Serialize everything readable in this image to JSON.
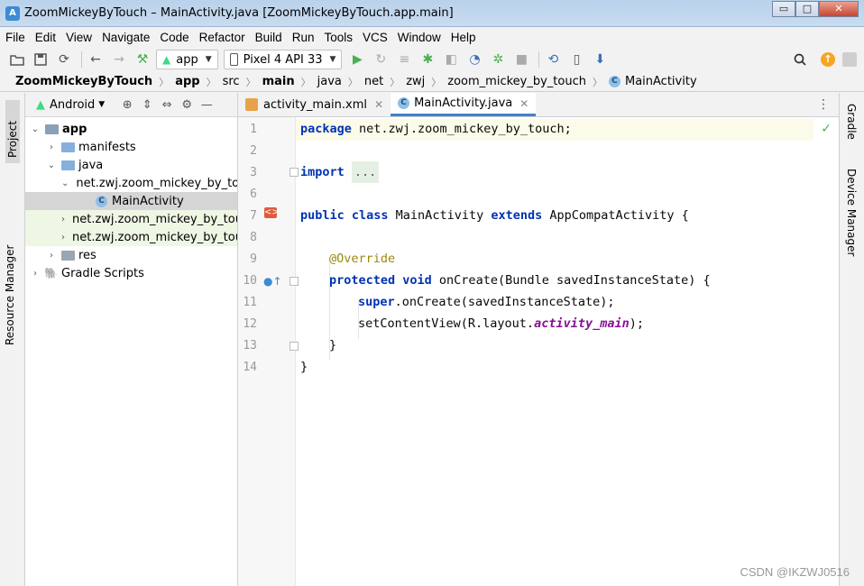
{
  "window": {
    "title": "ZoomMickeyByTouch – MainActivity.java [ZoomMickeyByTouch.app.main]",
    "controls": [
      "▭",
      "□",
      "✕"
    ]
  },
  "menu": [
    "File",
    "Edit",
    "View",
    "Navigate",
    "Code",
    "Refactor",
    "Build",
    "Run",
    "Tools",
    "VCS",
    "Window",
    "Help"
  ],
  "toolbar": {
    "run_config": "app",
    "device": "Pixel 4 API 33"
  },
  "breadcrumb": [
    "ZoomMickeyByTouch",
    "app",
    "src",
    "main",
    "java",
    "net",
    "zwj",
    "zoom_mickey_by_touch",
    "MainActivity"
  ],
  "left_strip": {
    "project_tab": "Project",
    "resource_tab": "Resource Manager"
  },
  "right_strip": {
    "gradle_tab": "Gradle",
    "device_tab": "Device Manager"
  },
  "project": {
    "view_mode": "Android",
    "tree": [
      {
        "label": "app",
        "depth": 0
      },
      {
        "label": "manifests",
        "depth": 1
      },
      {
        "label": "java",
        "depth": 1
      },
      {
        "label": "net.zwj.zoom_mickey_by_touch",
        "depth": 2
      },
      {
        "label": "MainActivity",
        "depth": 3
      },
      {
        "label": "net.zwj.zoom_mickey_by_touch",
        "depth": 2
      },
      {
        "label": "net.zwj.zoom_mickey_by_touch",
        "depth": 2
      },
      {
        "label": "res",
        "depth": 1
      },
      {
        "label": "Gradle Scripts",
        "depth": 0
      }
    ]
  },
  "tabs": [
    {
      "label": "activity_main.xml",
      "active": false
    },
    {
      "label": "MainActivity.java",
      "active": true
    }
  ],
  "editor": {
    "line_numbers": [
      "1",
      "2",
      "3",
      "6",
      "7",
      "8",
      "9",
      "10",
      "11",
      "12",
      "13",
      "14"
    ],
    "code": {
      "l1_kw": "package",
      "l1_rest": " net.zwj.zoom_mickey_by_touch;",
      "l3_kw": "import",
      "l3_fold": "...",
      "l7_kw1": "public class",
      "l7_name": " MainActivity ",
      "l7_kw2": "extends",
      "l7_rest": " AppCompatActivity {",
      "l9_ann": "@Override",
      "l10_kw": "protected void",
      "l10_rest": " onCreate(Bundle savedInstanceState) {",
      "l11_kw": "super",
      "l11_rest": ".onCreate(savedInstanceState);",
      "l12_pre": "setContentView(R.layout.",
      "l12_field": "activity_main",
      "l12_post": ");",
      "l13": "}",
      "l14": "}"
    }
  },
  "watermark": "CSDN @IKZWJ0516"
}
